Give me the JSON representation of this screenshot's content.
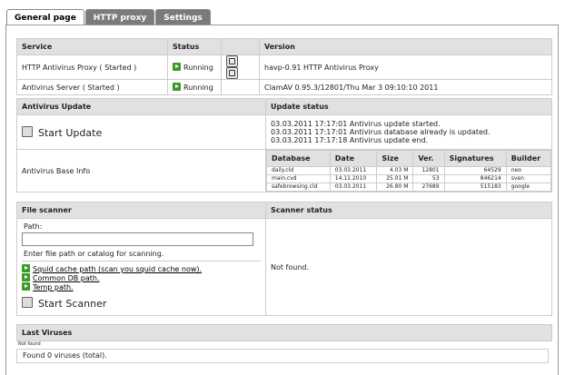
{
  "tabs": [
    "General page",
    "HTTP proxy",
    "Settings"
  ],
  "services": {
    "headers": [
      "Service",
      "Status",
      "",
      "Version"
    ],
    "rows": [
      {
        "service": "HTTP Antivirus Proxy ( Started )",
        "status": "Running",
        "version": "havp-0.91 HTTP Antivirus Proxy",
        "tool_icons": [
          "restart-icon",
          "stop-icon"
        ]
      },
      {
        "service": "Antivirus Server ( Started )",
        "status": "Running",
        "version": "ClamAV 0.95.3/12801/Thu Mar 3 09:10:10 2011",
        "tool_icons": []
      }
    ]
  },
  "antivirus_update": {
    "title": "Antivirus Update",
    "start_label": "Start Update",
    "base_info_label": "Antivirus Base Info",
    "status_title": "Update status",
    "log": [
      "03.03.2011 17:17:01 Antivirus update started.",
      "03.03.2011 17:17:01 Antivirus database already is updated.",
      "03.03.2011 17:17:18 Antivirus update end."
    ],
    "db_headers": [
      "Database",
      "Date",
      "Size",
      "Ver.",
      "Signatures",
      "Builder"
    ],
    "db_rows": [
      [
        "daily.cld",
        "03.03.2011",
        "4.03 M",
        "12801",
        "64529",
        "neo"
      ],
      [
        "main.cvd",
        "14.11.2010",
        "25.01 M",
        "53",
        "846214",
        "sven"
      ],
      [
        "safebrowsing.cld",
        "03.03.2011",
        "26.80 M",
        "27689",
        "515183",
        "google"
      ]
    ]
  },
  "file_scanner": {
    "title": "File scanner",
    "path_label": "Path:",
    "path_value": "",
    "hint": "Enter file path or catalog for scanning.",
    "links": [
      "Squid cache path (scan you squid cache now).",
      "Common DB path.",
      "Temp path."
    ],
    "start_label": "Start Scanner",
    "status_title": "Scanner status",
    "status_text": "Not found."
  },
  "last_viruses": {
    "title": "Last Viruses",
    "small_text": "Not found",
    "summary": "Found 0 viruses (total)."
  }
}
